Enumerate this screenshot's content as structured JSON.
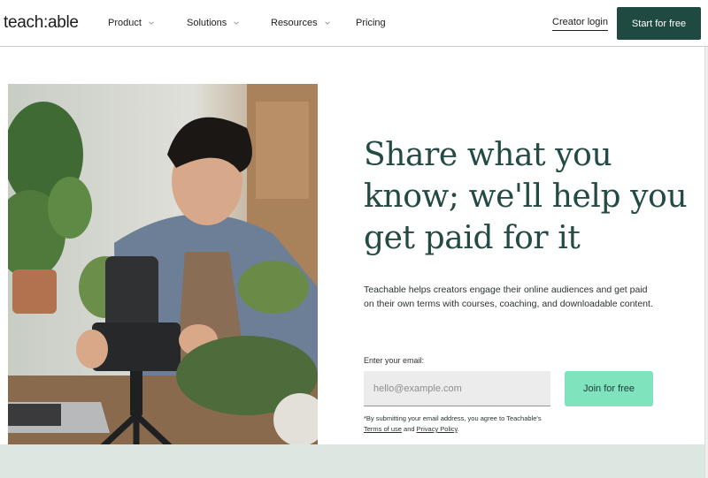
{
  "header": {
    "logo": "teach:able",
    "nav": [
      {
        "label": "Product",
        "has_dropdown": true
      },
      {
        "label": "Solutions",
        "has_dropdown": true
      },
      {
        "label": "Resources",
        "has_dropdown": true
      },
      {
        "label": "Pricing",
        "has_dropdown": false
      }
    ],
    "login_label": "Creator login",
    "start_label": "Start for free"
  },
  "hero": {
    "headline": "Share what you know; we'll help you get paid for it",
    "subtext": "Teachable helps creators engage their online audiences and get paid on their own terms with courses, coaching, and downloadable content.",
    "email_label": "Enter your email:",
    "email_placeholder": "hello@example.com",
    "email_value": "",
    "join_label": "Join for free",
    "legal": {
      "prefix": "*By submitting your email address, you agree to Teachable's ",
      "terms_link": "Terms of use",
      "middle": " and ",
      "privacy_link": "Privacy Policy",
      "suffix": "."
    }
  },
  "colors": {
    "brand_dark": "#1f4a42",
    "headline": "#244a44",
    "accent_mint": "#7fe3bd",
    "band": "#dde7e1"
  },
  "icons": [
    "chevron-down-icon"
  ]
}
